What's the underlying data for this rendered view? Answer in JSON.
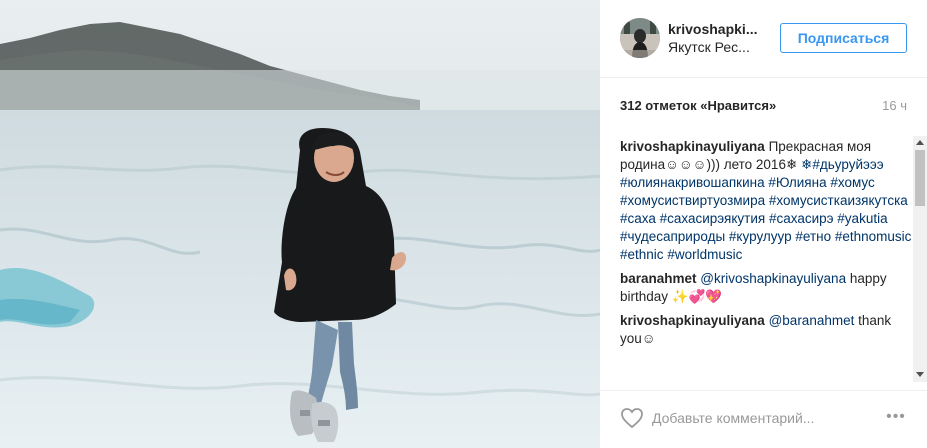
{
  "post": {
    "username": "krivoshapki...",
    "location": "Якутск Рес...",
    "follow_label": "Подписаться",
    "likes": "312 отметок «Нравится»",
    "time": "16 ч"
  },
  "caption": {
    "user": "krivoshapkinayuliyana",
    "text": "Прекрасная моя родина☺☺☺))) лето 2016❄",
    "tags": [
      "❄#дьуруйэээ",
      "#юлиянакривошапкина",
      "#Юлияна",
      "#хомус",
      "#хомусиствиртуозмира",
      "#хомусисткаизякутска",
      "#саха",
      "#сахасирэякутия",
      "#сахасирэ",
      "#yakutia",
      "#чудесаприроды",
      "#курулуур",
      "#етно",
      "#ethnomusic",
      "#ethnic",
      "#worldmusic"
    ]
  },
  "comments": [
    {
      "user": "baranahmet",
      "mention": "@krivoshapkinayuliyana",
      "text": "happy birthday ✨💞💖"
    },
    {
      "user": "krivoshapkinayuliyana",
      "mention": "@baranahmet",
      "text": "thank you☺"
    }
  ],
  "add_comment": {
    "placeholder": "Добавьте комментарий...",
    "heart_icon": "heart-outline-icon",
    "more_icon": "ellipsis-icon",
    "more_label": "•••"
  },
  "colors": {
    "accent": "#3897f0",
    "hashtag": "#003569",
    "muted": "#999999"
  }
}
